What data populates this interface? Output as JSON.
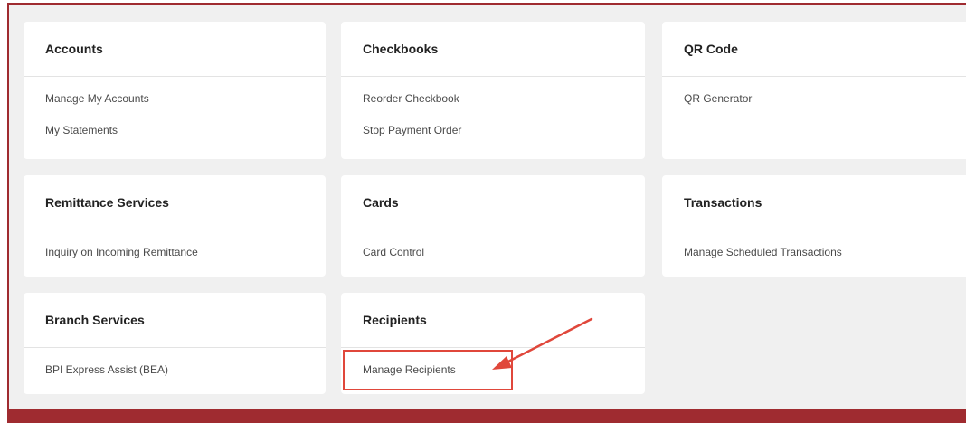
{
  "colors": {
    "frame_border": "#9f2b30",
    "bottom_bar": "#9f2b30",
    "annotation": "#e0473b"
  },
  "sections": [
    {
      "title": "Accounts",
      "items": [
        "Manage My Accounts",
        "My Statements"
      ]
    },
    {
      "title": "Checkbooks",
      "items": [
        "Reorder Checkbook",
        "Stop Payment Order"
      ]
    },
    {
      "title": "QR Code",
      "items": [
        "QR Generator"
      ]
    },
    {
      "title": "Remittance Services",
      "items": [
        "Inquiry on Incoming Remittance"
      ]
    },
    {
      "title": "Cards",
      "items": [
        "Card Control"
      ]
    },
    {
      "title": "Transactions",
      "items": [
        "Manage Scheduled Transactions"
      ]
    },
    {
      "title": "Branch Services",
      "items": [
        "BPI Express Assist (BEA)"
      ]
    },
    {
      "title": "Recipients",
      "items": [
        "Manage Recipients"
      ]
    }
  ],
  "annotation": {
    "highlighted_item": "Manage Recipients",
    "icon": "arrow-pointer"
  }
}
